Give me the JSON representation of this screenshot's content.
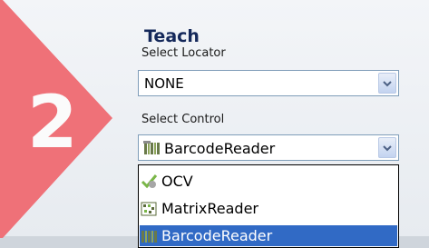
{
  "step": {
    "number": "2",
    "title": "Teach"
  },
  "locator": {
    "label": "Select Locator",
    "value": "NONE"
  },
  "control": {
    "label": "Select Control",
    "value": "BarcodeReader",
    "value_icon": "barcode-reader-icon"
  },
  "control_options": [
    {
      "label": "OCV",
      "icon": "ocv-icon",
      "selected": false
    },
    {
      "label": "MatrixReader",
      "icon": "matrix-reader-icon",
      "selected": false
    },
    {
      "label": "BarcodeReader",
      "icon": "barcode-reader-icon",
      "selected": true
    }
  ],
  "colors": {
    "step_arrow": "#ef7178",
    "title": "#14285a",
    "selection": "#316ac5"
  }
}
